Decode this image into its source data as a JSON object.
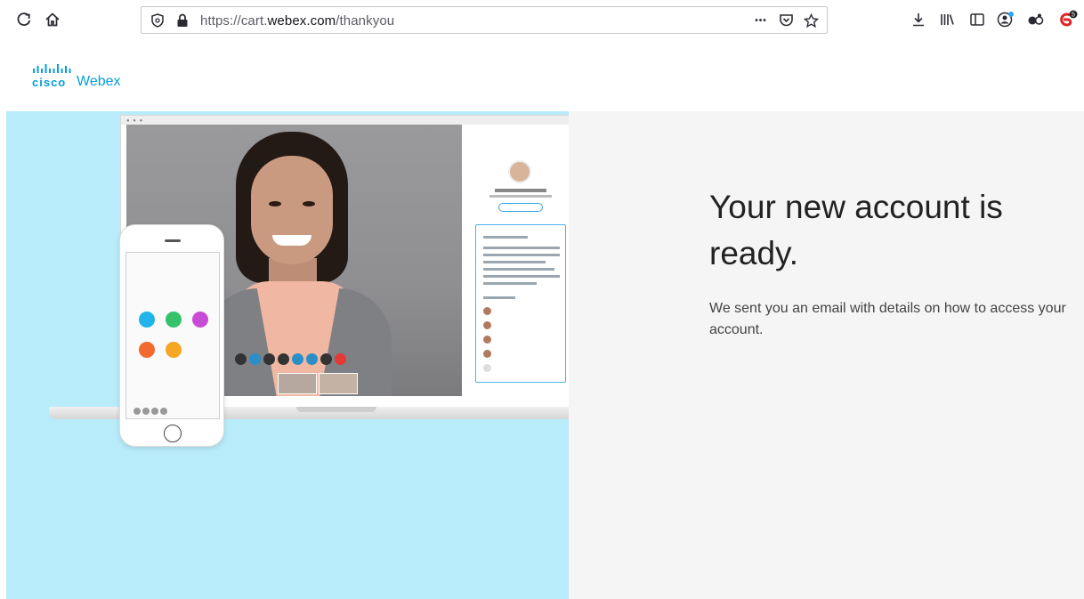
{
  "browser": {
    "url_prefix": "https://cart.",
    "url_domain": "webex.com",
    "url_path": "/thankyou",
    "more_glyph": "•••",
    "extension_badge": "5"
  },
  "logo": {
    "cisco": "cisco",
    "webex": "Webex"
  },
  "hero": {
    "headline": "Your new account is ready.",
    "subtext": "We sent you an email with details on how to access your account."
  },
  "colors": {
    "accent": "#049fd9",
    "hero_left_bg": "#b8ecfa",
    "hero_right_bg": "#f5f5f5"
  }
}
